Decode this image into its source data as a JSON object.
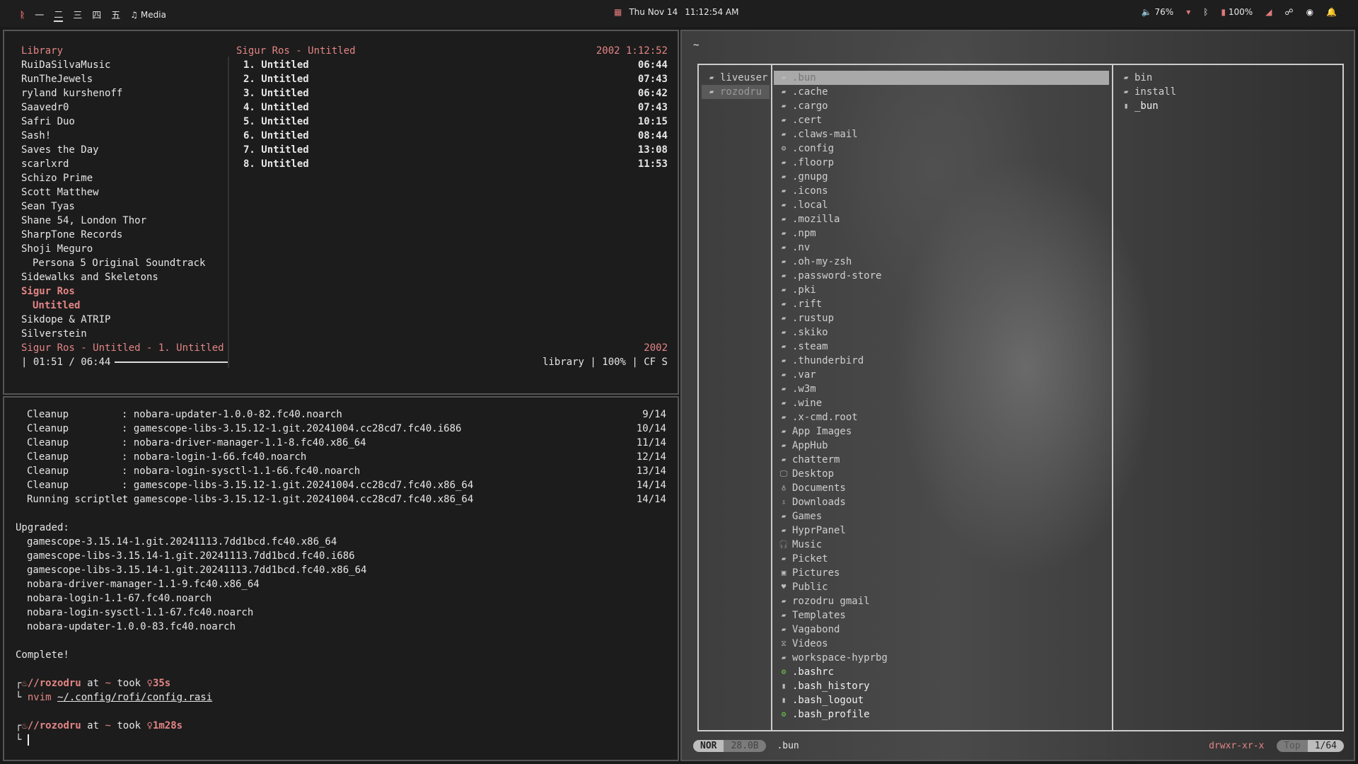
{
  "topbar": {
    "workspace_glyphs": [
      "一",
      "二",
      "三",
      "四",
      "五"
    ],
    "media_label": "Media",
    "date": "Thu Nov 14",
    "time": "11:12:54 AM",
    "volume": "76%",
    "battery": "100%"
  },
  "mpd": {
    "library_title": "Library",
    "library": [
      "RuiDaSilvaMusic",
      "RunTheJewels",
      "ryland kurshenoff",
      "Saavedr0",
      "Safri Duo",
      "Sash!",
      "Saves the Day",
      "scarlxrd",
      "Schizo Prime",
      "Scott Matthew",
      "Sean Tyas",
      "Shane 54, London Thor",
      "SharpTone Records",
      "Shoji Meguro"
    ],
    "library_sub": "Persona 5 Original Soundtrack",
    "library_after": "Sidewalks and Skeletons",
    "library_selected": "Sigur Ros",
    "library_selected_sub": "Untitled",
    "library_tail": [
      "Sikdope & ATRIP",
      "Silverstein"
    ],
    "album_title": "Sigur Ros - Untitled",
    "album_meta": "2002 1:12:52",
    "tracks": [
      {
        "label": "1. Untitled",
        "dur": "06:44"
      },
      {
        "label": "2. Untitled",
        "dur": "07:43"
      },
      {
        "label": "3. Untitled",
        "dur": "06:42"
      },
      {
        "label": "4. Untitled",
        "dur": "07:43"
      },
      {
        "label": "5. Untitled",
        "dur": "10:15"
      },
      {
        "label": "6. Untitled",
        "dur": "08:44"
      },
      {
        "label": "7. Untitled",
        "dur": "13:08"
      },
      {
        "label": "8. Untitled",
        "dur": "11:53"
      }
    ],
    "now_playing": "Sigur Ros - Untitled - 1. Untitled",
    "now_year": "2002",
    "elapsed": "| 01:51 / 06:44",
    "progress_fraction": 0.27,
    "status_right": "library | 100% | CF S"
  },
  "terminal": {
    "txn": [
      {
        "a": "Cleanup",
        "b": ": nobara-updater-1.0.0-82.fc40.noarch",
        "c": "9/14"
      },
      {
        "a": "Cleanup",
        "b": ": gamescope-libs-3.15.12-1.git.20241004.cc28cd7.fc40.i686",
        "c": "10/14"
      },
      {
        "a": "Cleanup",
        "b": ": nobara-driver-manager-1.1-8.fc40.x86_64",
        "c": "11/14"
      },
      {
        "a": "Cleanup",
        "b": ": nobara-login-1-66.fc40.noarch",
        "c": "12/14"
      },
      {
        "a": "Cleanup",
        "b": ": nobara-login-sysctl-1.1-66.fc40.noarch",
        "c": "13/14"
      },
      {
        "a": "Cleanup",
        "b": ": gamescope-libs-3.15.12-1.git.20241004.cc28cd7.fc40.x86_64",
        "c": "14/14"
      },
      {
        "a": "Running scriptlet",
        "b": ": gamescope-libs-3.15.12-1.git.20241004.cc28cd7.fc40.x86_64",
        "c": "14/14"
      }
    ],
    "upgraded_title": "Upgraded:",
    "upgraded": [
      "gamescope-3.15.14-1.git.20241113.7dd1bcd.fc40.x86_64",
      "gamescope-libs-3.15.14-1.git.20241113.7dd1bcd.fc40.i686",
      "gamescope-libs-3.15.14-1.git.20241113.7dd1bcd.fc40.x86_64",
      "nobara-driver-manager-1.1-9.fc40.x86_64",
      "nobara-login-1.1-67.fc40.noarch",
      "nobara-login-sysctl-1.1-67.fc40.noarch",
      "nobara-updater-1.0.0-83.fc40.noarch"
    ],
    "complete": "Complete!",
    "prompt1_user": "//rozodru",
    "prompt_at": "at",
    "prompt_dir": "~",
    "prompt_took": "took",
    "prompt1_time": "35s",
    "cmd_prefix": "nvim",
    "cmd_path": "~/.config/rofi/config.rasi",
    "prompt2_user": "//rozodru",
    "prompt2_time": "1m28s"
  },
  "yazi": {
    "cwd": "~",
    "parents": [
      {
        "name": "liveuser",
        "sel": false
      },
      {
        "name": "rozodru",
        "sel": true
      }
    ],
    "entries": [
      {
        "n": ".bun",
        "i": "folder",
        "sel": true
      },
      {
        "n": ".cache",
        "i": "folder"
      },
      {
        "n": ".cargo",
        "i": "folder"
      },
      {
        "n": ".cert",
        "i": "folder"
      },
      {
        "n": ".claws-mail",
        "i": "folder"
      },
      {
        "n": ".config",
        "i": "config"
      },
      {
        "n": ".floorp",
        "i": "folder"
      },
      {
        "n": ".gnupg",
        "i": "folder"
      },
      {
        "n": ".icons",
        "i": "folder"
      },
      {
        "n": ".local",
        "i": "folder"
      },
      {
        "n": ".mozilla",
        "i": "folder"
      },
      {
        "n": ".npm",
        "i": "folder"
      },
      {
        "n": ".nv",
        "i": "folder"
      },
      {
        "n": ".oh-my-zsh",
        "i": "folder"
      },
      {
        "n": ".password-store",
        "i": "folder"
      },
      {
        "n": ".pki",
        "i": "folder"
      },
      {
        "n": ".rift",
        "i": "folder"
      },
      {
        "n": ".rustup",
        "i": "folder"
      },
      {
        "n": ".skiko",
        "i": "folder"
      },
      {
        "n": ".steam",
        "i": "folder"
      },
      {
        "n": ".thunderbird",
        "i": "folder"
      },
      {
        "n": ".var",
        "i": "folder"
      },
      {
        "n": ".w3m",
        "i": "folder"
      },
      {
        "n": ".wine",
        "i": "folder"
      },
      {
        "n": ".x-cmd.root",
        "i": "folder"
      },
      {
        "n": "App Images",
        "i": "folder"
      },
      {
        "n": "AppHub",
        "i": "folder"
      },
      {
        "n": "chatterm",
        "i": "folder"
      },
      {
        "n": "Desktop",
        "i": "desktop"
      },
      {
        "n": "Documents",
        "i": "documents"
      },
      {
        "n": "Downloads",
        "i": "downloads"
      },
      {
        "n": "Games",
        "i": "folder"
      },
      {
        "n": "HyprPanel",
        "i": "folder"
      },
      {
        "n": "Music",
        "i": "music"
      },
      {
        "n": "Picket",
        "i": "folder"
      },
      {
        "n": "Pictures",
        "i": "pictures"
      },
      {
        "n": "Public",
        "i": "public"
      },
      {
        "n": "rozodru gmail",
        "i": "folder"
      },
      {
        "n": "Templates",
        "i": "folder"
      },
      {
        "n": "Vagabond",
        "i": "folder"
      },
      {
        "n": "Videos",
        "i": "videos"
      },
      {
        "n": "workspace-hyprbg",
        "i": "folder"
      },
      {
        "n": ".bashrc",
        "i": "gear",
        "file": true
      },
      {
        "n": ".bash_history",
        "i": "file",
        "file": true
      },
      {
        "n": ".bash_logout",
        "i": "file",
        "file": true
      },
      {
        "n": ".bash_profile",
        "i": "gear",
        "file": true
      }
    ],
    "preview": [
      {
        "n": "bin",
        "i": "folder"
      },
      {
        "n": "install",
        "i": "folder"
      },
      {
        "n": "_bun",
        "i": "file",
        "file": true
      }
    ],
    "mode": "NOR",
    "size": "28.0B",
    "current": ".bun",
    "perms": "drwxr-xr-x",
    "scroll": "Top",
    "position": "1/64"
  }
}
